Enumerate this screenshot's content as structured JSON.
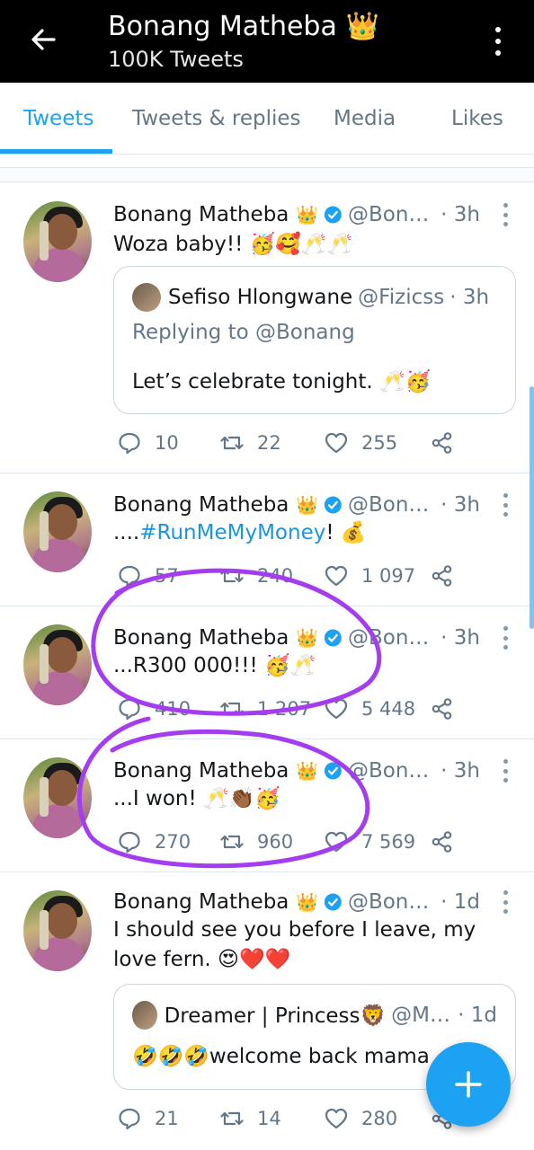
{
  "header": {
    "title": "Bonang Matheba",
    "title_emoji": "👑",
    "subtitle": "100K Tweets"
  },
  "tabs": [
    {
      "label": "Tweets",
      "active": true
    },
    {
      "label": "Tweets & replies",
      "active": false
    },
    {
      "label": "Media",
      "active": false
    },
    {
      "label": "Likes",
      "active": false
    }
  ],
  "colors": {
    "accent": "#1da1f2",
    "annotation": "#a43cf0"
  },
  "tweets": [
    {
      "name": "Bonang Matheba",
      "crown": "👑",
      "handle": "@Bona...",
      "time": "· 3h",
      "text": "Woza baby!! 🥳🥰🥂🥂",
      "quote": {
        "name": "Sefiso Hlongwane",
        "handle": "@Fizicss",
        "time": "· 3h",
        "reply_to": "Replying to @Bonang",
        "text": "Let’s celebrate tonight. 🥂🥳"
      },
      "replies": "10",
      "retweets": "22",
      "likes": "255"
    },
    {
      "name": "Bonang Matheba",
      "crown": "👑",
      "handle": "@Bona...",
      "time": "· 3h",
      "text_prefix": "....",
      "hashtag": "#RunMeMyMoney",
      "text_suffix": "! 💰",
      "replies": "57",
      "retweets": "240",
      "likes": "1 097"
    },
    {
      "name": "Bonang Matheba",
      "crown": "👑",
      "handle": "@Bona...",
      "time": "· 3h",
      "text": "...R300 000!!! 🥳🥂",
      "replies": "410",
      "retweets": "1 207",
      "likes": "5 448"
    },
    {
      "name": "Bonang Matheba",
      "crown": "👑",
      "handle": "@Bona...",
      "time": "· 3h",
      "text": "...I won! 🥂👏🏾🥳",
      "replies": "270",
      "retweets": "960",
      "likes": "7 569"
    },
    {
      "name": "Bonang Matheba",
      "crown": "👑",
      "handle": "@Bona...",
      "time": "· 1d",
      "text": "I should see you before I leave, my love fern. 😍❤️❤️",
      "quote": {
        "name": "Dreamer | Princess🦁",
        "handle": "@Ma...",
        "time": "· 1d",
        "text": "🤣🤣🤣welcome back mama"
      },
      "replies": "21",
      "retweets": "14",
      "likes": "280"
    }
  ]
}
